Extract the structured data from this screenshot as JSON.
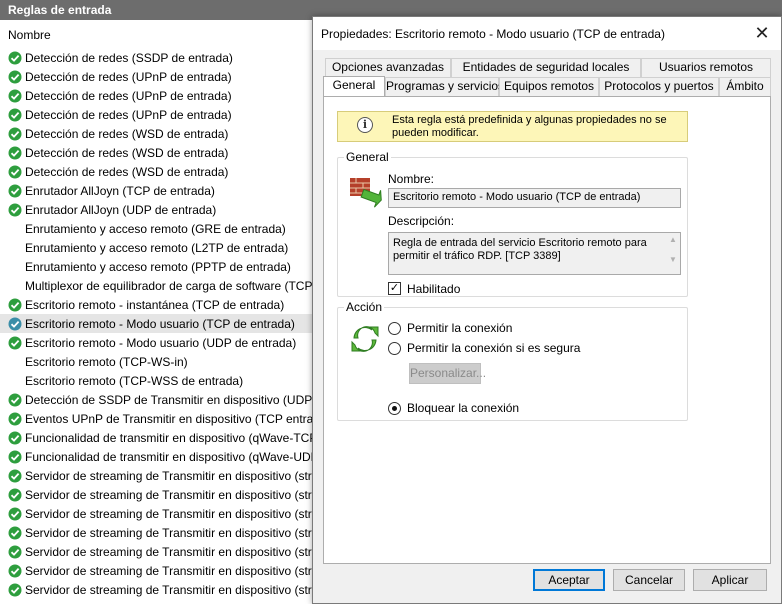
{
  "background": {
    "panel_title": "Reglas de entrada",
    "column_header": "Nombre",
    "colors": {
      "enabled_icon": "#2e9e3e",
      "header_bg": "#6d6d6d",
      "selected_row": "#e5e5e5"
    },
    "rules": [
      {
        "label": "Detección de redes (SSDP de entrada)",
        "icon": "check-enabled-icon"
      },
      {
        "label": "Detección de redes (UPnP de entrada)",
        "icon": "check-enabled-icon"
      },
      {
        "label": "Detección de redes (UPnP de entrada)",
        "icon": "check-enabled-icon"
      },
      {
        "label": "Detección de redes (UPnP de entrada)",
        "icon": "check-enabled-icon"
      },
      {
        "label": "Detección de redes (WSD de entrada)",
        "icon": "check-enabled-icon"
      },
      {
        "label": "Detección de redes (WSD de entrada)",
        "icon": "check-enabled-icon"
      },
      {
        "label": "Detección de redes (WSD de entrada)",
        "icon": "check-enabled-icon"
      },
      {
        "label": "Enrutador AllJoyn (TCP de entrada)",
        "icon": "check-enabled-icon"
      },
      {
        "label": "Enrutador AllJoyn (UDP de entrada)",
        "icon": "check-enabled-icon"
      },
      {
        "label": "Enrutamiento y acceso remoto (GRE de entrada)",
        "icon": "none"
      },
      {
        "label": "Enrutamiento y acceso remoto (L2TP de entrada)",
        "icon": "none"
      },
      {
        "label": "Enrutamiento y acceso remoto (PPTP de entrada)",
        "icon": "none"
      },
      {
        "label": "Multiplexor de equilibrador de carga de software (TCP-",
        "icon": "none"
      },
      {
        "label": "Escritorio remoto - instantánea (TCP de entrada)",
        "icon": "check-enabled-icon"
      },
      {
        "label": "Escritorio remoto - Modo usuario (TCP de entrada)",
        "icon": "selected-rule-icon",
        "selected": true
      },
      {
        "label": "Escritorio remoto - Modo usuario (UDP de entrada)",
        "icon": "check-enabled-icon"
      },
      {
        "label": "Escritorio remoto (TCP-WS-in)",
        "icon": "none"
      },
      {
        "label": "Escritorio remoto (TCP-WSS de entrada)",
        "icon": "none"
      },
      {
        "label": "Detección de SSDP de Transmitir en dispositivo (UDP e",
        "icon": "check-enabled-icon"
      },
      {
        "label": "Eventos UPnP de Transmitir en dispositivo (TCP entran",
        "icon": "check-enabled-icon"
      },
      {
        "label": "Funcionalidad de transmitir en dispositivo (qWave-TCP",
        "icon": "check-enabled-icon"
      },
      {
        "label": "Funcionalidad de transmitir en dispositivo (qWave-UDP",
        "icon": "check-enabled-icon"
      },
      {
        "label": "Servidor de streaming de Transmitir en dispositivo (stre",
        "icon": "check-enabled-icon"
      },
      {
        "label": "Servidor de streaming de Transmitir en dispositivo (stre",
        "icon": "check-enabled-icon"
      },
      {
        "label": "Servidor de streaming de Transmitir en dispositivo (stre",
        "icon": "check-enabled-icon"
      },
      {
        "label": "Servidor de streaming de Transmitir en dispositivo (stre",
        "icon": "check-enabled-icon"
      },
      {
        "label": "Servidor de streaming de Transmitir en dispositivo (stre",
        "icon": "check-enabled-icon"
      },
      {
        "label": "Servidor de streaming de Transmitir en dispositivo (stre",
        "icon": "check-enabled-icon"
      },
      {
        "label": "Servidor de streaming de Transmitir en dispositivo (stre",
        "icon": "check-enabled-icon"
      }
    ]
  },
  "dialog": {
    "title": "Propiedades: Escritorio remoto - Modo usuario (TCP de entrada)",
    "close_icon": "close-icon",
    "tabs_back": [
      "Opciones avanzadas",
      "Entidades de seguridad locales",
      "Usuarios remotos"
    ],
    "tabs_front": [
      "General",
      "Programas y servicios",
      "Equipos remotos",
      "Protocolos y puertos",
      "Ámbito"
    ],
    "active_tab": "General",
    "notice": {
      "icon": "info-icon",
      "line1": "Esta regla está predefinida y algunas propiedades no se",
      "line2": "pueden modificar."
    },
    "general": {
      "group_title": "General",
      "icon": "firewall-icon",
      "name_label": "Nombre:",
      "name_value": "Escritorio remoto - Modo usuario (TCP de entrada)",
      "description_label": "Descripción:",
      "description_line1": "Regla de entrada del servicio Escritorio remoto para",
      "description_line2": "permitir el tráfico RDP. [TCP 3389]",
      "enabled_label": "Habilitado",
      "enabled": true
    },
    "action": {
      "group_title": "Acción",
      "icon": "refresh-arrows-icon",
      "options": [
        "Permitir la conexión",
        "Permitir la conexión si es segura",
        "Bloquear la conexión"
      ],
      "selected": "Bloquear la conexión",
      "customize_label": "Personalizar..."
    },
    "buttons": {
      "ok": "Aceptar",
      "cancel": "Cancelar",
      "apply": "Aplicar"
    },
    "colors": {
      "notice_bg": "#fdf6b8",
      "default_button_border": "#0078d7"
    }
  }
}
